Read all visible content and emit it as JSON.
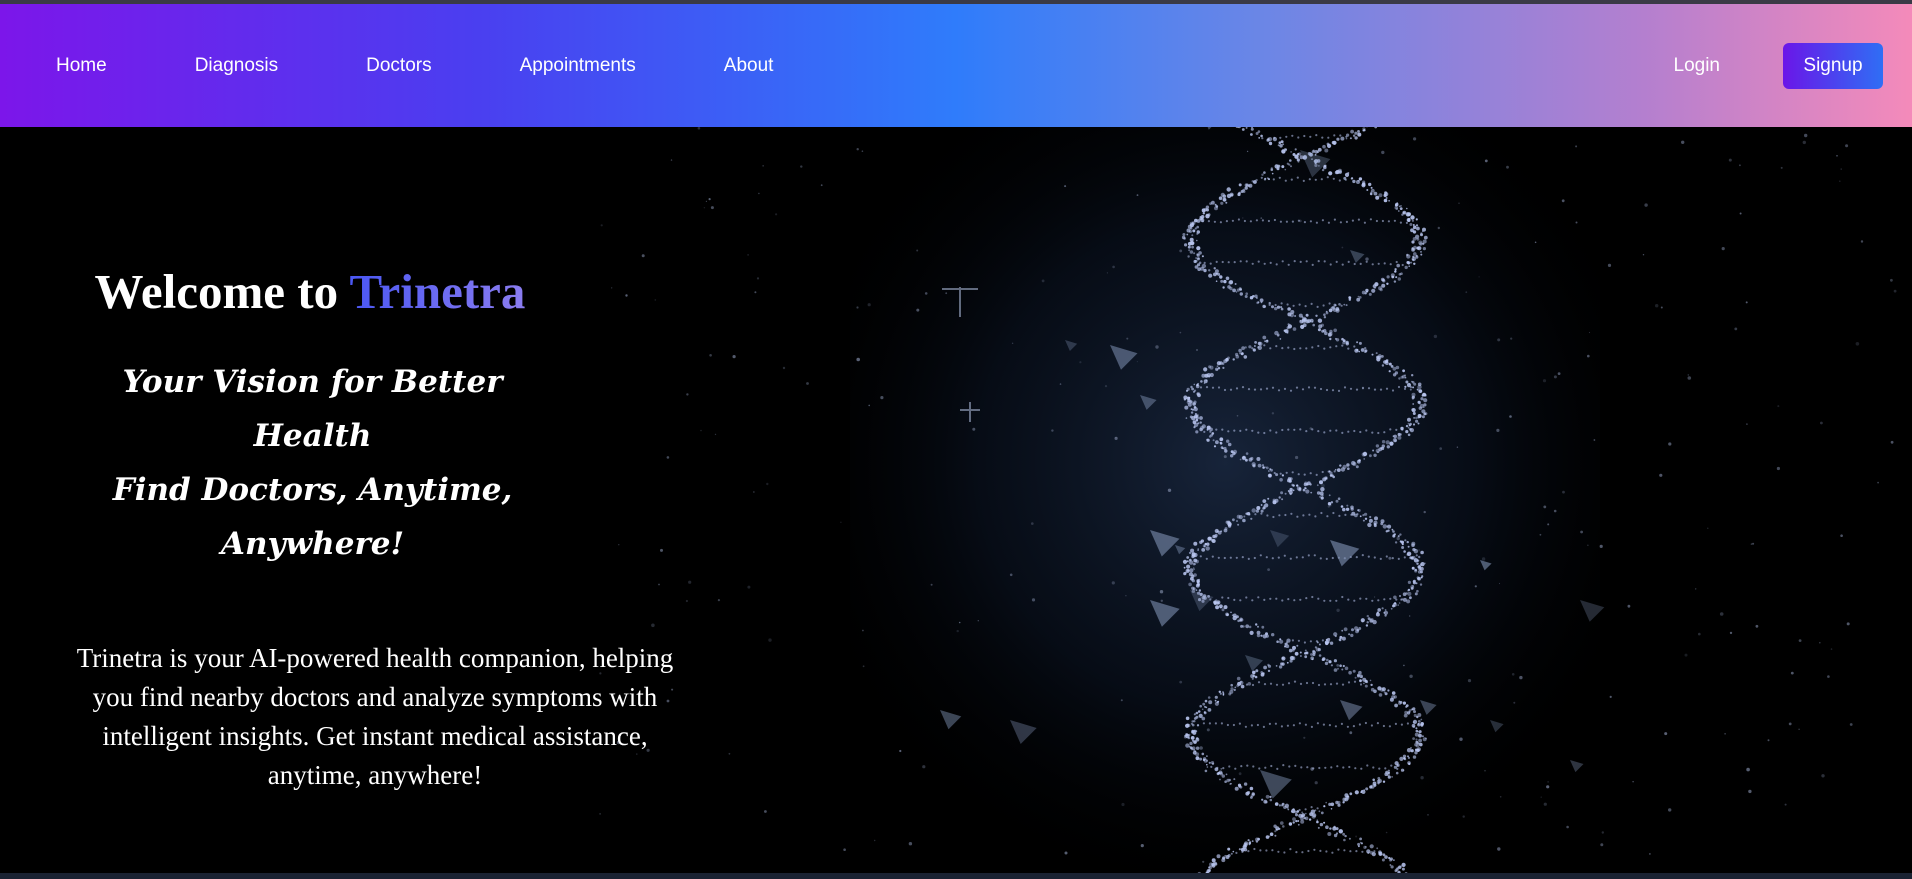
{
  "nav": {
    "links": [
      "Home",
      "Diagnosis",
      "Doctors",
      "Appointments",
      "About"
    ],
    "login_label": "Login",
    "signup_label": "Signup"
  },
  "hero": {
    "welcome_prefix": "Welcome to ",
    "brand": "Trinetra",
    "tagline_lines": [
      "Your Vision for Better Health",
      "Find Doctors, Anytime,",
      "Anywhere!"
    ],
    "description": "Trinetra is your AI-powered health companion, helping you find nearby doctors and analyze symptoms with intelligent insights. Get instant medical assistance, anytime, anywhere!",
    "background_image": "dna-helix"
  },
  "colors": {
    "nav_gradient_start": "#7c16ea",
    "nav_gradient_mid": "#2f7cfb",
    "nav_gradient_end": "#f48aba",
    "brand_gradient_start": "#4a57f3",
    "brand_gradient_end": "#8b7df0",
    "dna_color": "#b9c6f0"
  }
}
